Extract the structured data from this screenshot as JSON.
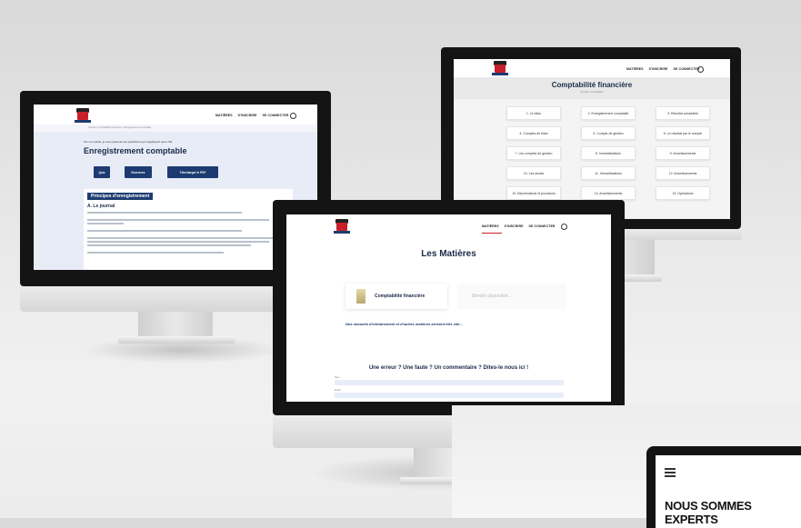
{
  "monitor_left": {
    "nav": [
      "MATIÈRES",
      "S'INSCRIRE",
      "SE CONNECTER"
    ],
    "breadcrumb": "Accueil  /  Comptabilité financière  /  Enregistrement comptable",
    "intro": "Sur ce module, je vous présente les opérations qui s'appliquent avec 700",
    "title": "Enregistrement comptable",
    "buttons": [
      "Quiz",
      "Exercices",
      "Télécharger le PDF"
    ],
    "section_title": "Principes d'enregistrement",
    "subsection": "A. Le journal"
  },
  "monitor_right": {
    "nav": [
      "MATIÈRES",
      "S'INSCRIRE",
      "SE CONNECTER"
    ],
    "title": "Comptabilité financière",
    "breadcrumb": "Accueil  /  Comptabilité",
    "chapters": [
      "1. Le bilan",
      "2. Enregistrement comptable",
      "3. Résultat comptable",
      "4. Comptes de bilan",
      "5. Compte de gestion",
      "6. Le résultat par le compte",
      "7. Les comptes de gestion",
      "8. Immobilisations",
      "9. Amortissements",
      "10. Les stocks",
      "11. Immobilisations",
      "12. Amortissements",
      "13. Dépréciations et provisions",
      "14. Amortissements",
      "15. Opérations"
    ]
  },
  "monitor_center": {
    "nav": [
      "MATIÈRES",
      "S'INSCRIRE",
      "SE CONNECTER"
    ],
    "title": "Les Matières",
    "card_label": "Comptabilité financière",
    "card_placeholder": "Bientôt disponible...",
    "note": "Nos manuels d'entraînement et d'autres matières arrivent très vite...",
    "feedback": "Une erreur ? Une faute ? Un commentaire ? Dites-le nous ici !",
    "field1": "Nom",
    "field2": "Email"
  },
  "phone": {
    "heading": "NOUS SOMMES EXPERTS"
  }
}
